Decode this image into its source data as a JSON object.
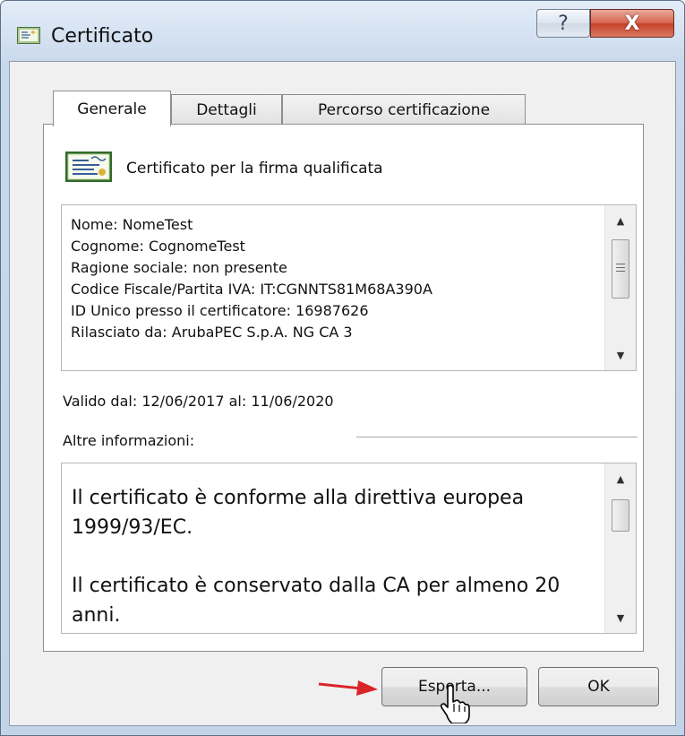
{
  "window": {
    "title": "Certificato",
    "help_symbol": "?",
    "close_symbol": "X"
  },
  "tabs": [
    {
      "label": "Generale",
      "active": true
    },
    {
      "label": "Dettagli",
      "active": false
    },
    {
      "label": "Percorso certificazione",
      "active": false
    }
  ],
  "general": {
    "cert_title": "Certificato per la firma qualificata",
    "info_lines": [
      "Nome: NomeTest",
      "Cognome: CognomeTest",
      "Ragione sociale: non presente",
      "Codice Fiscale/Partita IVA: IT:CGNNTS81M68A390A",
      "ID Unico presso il certificatore: 16987626",
      "Rilasciato da: ArubaPEC S.p.A. NG CA 3"
    ],
    "validity": "Valido dal: 12/06/2017 al: 11/06/2020",
    "other_label": "Altre informazioni:",
    "other_paragraphs": [
      "Il certificato è conforme alla direttiva europea 1999/93/EC.",
      "Il certificato è conservato dalla CA per almeno 20 anni."
    ]
  },
  "buttons": {
    "export_label": "Esporta...",
    "ok_label": "OK"
  },
  "icons": {
    "window_icon": "certificate-icon",
    "cert_icon": "certificate-icon",
    "cursor": "hand-pointer-cursor",
    "arrow": "red-arrow",
    "scroll_up": "scroll-up-arrow",
    "scroll_down": "scroll-down-arrow"
  },
  "colors": {
    "accent_arrow": "#d9252a",
    "close_button": "#c5412a"
  }
}
